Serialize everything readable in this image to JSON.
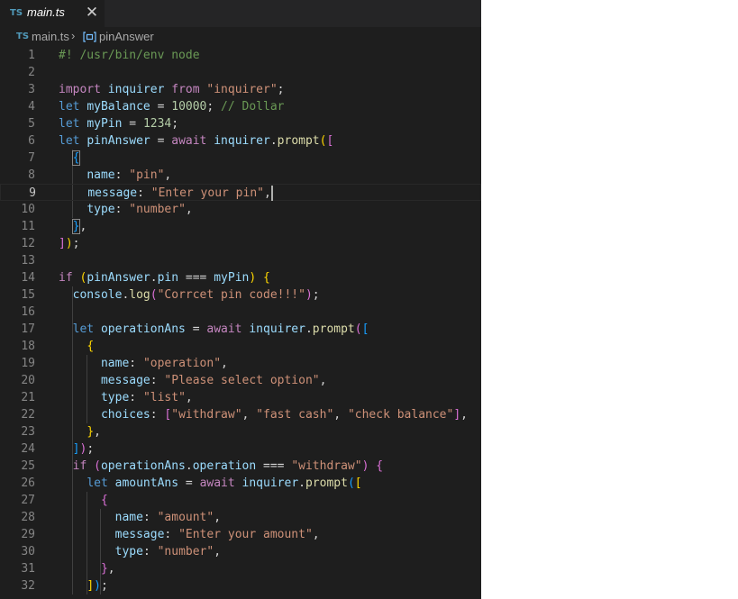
{
  "tab": {
    "lang_badge": "TS",
    "title": "main.ts",
    "close_glyph": "✕"
  },
  "breadcrumb": {
    "lang_badge": "TS",
    "file": "main.ts",
    "separator": "›",
    "symbol": "pinAnswer",
    "symbol_icon": "variable-icon"
  },
  "editor": {
    "cursor_line": 9,
    "lines": [
      {
        "n": "1",
        "tokens": [
          [
            "c",
            "#! /usr/bin/env node"
          ]
        ]
      },
      {
        "n": "2",
        "tokens": []
      },
      {
        "n": "3",
        "tokens": [
          [
            "kw",
            "import"
          ],
          [
            "p",
            " "
          ],
          [
            "v",
            "inquirer"
          ],
          [
            "p",
            " "
          ],
          [
            "kw",
            "from"
          ],
          [
            "p",
            " "
          ],
          [
            "s",
            "\"inquirer\""
          ],
          [
            "p",
            ";"
          ]
        ]
      },
      {
        "n": "4",
        "tokens": [
          [
            "kd",
            "let"
          ],
          [
            "p",
            " "
          ],
          [
            "v",
            "myBalance"
          ],
          [
            "p",
            " = "
          ],
          [
            "n",
            "10000"
          ],
          [
            "p",
            "; "
          ],
          [
            "c",
            "// Dollar"
          ]
        ]
      },
      {
        "n": "5",
        "tokens": [
          [
            "kd",
            "let"
          ],
          [
            "p",
            " "
          ],
          [
            "v",
            "myPin"
          ],
          [
            "p",
            " = "
          ],
          [
            "n",
            "1234"
          ],
          [
            "p",
            ";"
          ]
        ]
      },
      {
        "n": "6",
        "tokens": [
          [
            "kd",
            "let"
          ],
          [
            "p",
            " "
          ],
          [
            "v",
            "pinAnswer"
          ],
          [
            "p",
            " = "
          ],
          [
            "kw",
            "await"
          ],
          [
            "p",
            " "
          ],
          [
            "v",
            "inquirer"
          ],
          [
            "p",
            "."
          ],
          [
            "f",
            "prompt"
          ],
          [
            "b1",
            "("
          ],
          [
            "b2",
            "["
          ]
        ]
      },
      {
        "n": "7",
        "tokens": [
          [
            "p",
            "  "
          ],
          [
            "b3 bm",
            "{"
          ]
        ]
      },
      {
        "n": "8",
        "tokens": [
          [
            "p",
            "    "
          ],
          [
            "v",
            "name"
          ],
          [
            "p",
            ": "
          ],
          [
            "s",
            "\"pin\""
          ],
          [
            "p",
            ","
          ]
        ]
      },
      {
        "n": "9",
        "tokens": [
          [
            "p",
            "    "
          ],
          [
            "v",
            "message"
          ],
          [
            "p",
            ": "
          ],
          [
            "s",
            "\"Enter your pin\""
          ],
          [
            "p",
            ","
          ]
        ]
      },
      {
        "n": "10",
        "tokens": [
          [
            "p",
            "    "
          ],
          [
            "v",
            "type"
          ],
          [
            "p",
            ": "
          ],
          [
            "s",
            "\"number\""
          ],
          [
            "p",
            ","
          ]
        ]
      },
      {
        "n": "11",
        "tokens": [
          [
            "p",
            "  "
          ],
          [
            "b3 bm",
            "}"
          ],
          [
            "p",
            ","
          ]
        ]
      },
      {
        "n": "12",
        "tokens": [
          [
            "b2",
            "]"
          ],
          [
            "b1",
            ")"
          ],
          [
            "p",
            ";"
          ]
        ]
      },
      {
        "n": "13",
        "tokens": []
      },
      {
        "n": "14",
        "tokens": [
          [
            "kw",
            "if"
          ],
          [
            "p",
            " "
          ],
          [
            "b1",
            "("
          ],
          [
            "v",
            "pinAnswer"
          ],
          [
            "p",
            "."
          ],
          [
            "v",
            "pin"
          ],
          [
            "p",
            " === "
          ],
          [
            "v",
            "myPin"
          ],
          [
            "b1",
            ")"
          ],
          [
            "p",
            " "
          ],
          [
            "b1",
            "{"
          ]
        ]
      },
      {
        "n": "15",
        "tokens": [
          [
            "p",
            "  "
          ],
          [
            "v",
            "console"
          ],
          [
            "p",
            "."
          ],
          [
            "f",
            "log"
          ],
          [
            "b2",
            "("
          ],
          [
            "s",
            "\"Corrcet pin code!!!\""
          ],
          [
            "b2",
            ")"
          ],
          [
            "p",
            ";"
          ]
        ]
      },
      {
        "n": "16",
        "tokens": []
      },
      {
        "n": "17",
        "tokens": [
          [
            "p",
            "  "
          ],
          [
            "kd",
            "let"
          ],
          [
            "p",
            " "
          ],
          [
            "v",
            "operationAns"
          ],
          [
            "p",
            " = "
          ],
          [
            "kw",
            "await"
          ],
          [
            "p",
            " "
          ],
          [
            "v",
            "inquirer"
          ],
          [
            "p",
            "."
          ],
          [
            "f",
            "prompt"
          ],
          [
            "b2",
            "("
          ],
          [
            "b3",
            "["
          ]
        ]
      },
      {
        "n": "18",
        "tokens": [
          [
            "p",
            "    "
          ],
          [
            "b1",
            "{"
          ]
        ]
      },
      {
        "n": "19",
        "tokens": [
          [
            "p",
            "      "
          ],
          [
            "v",
            "name"
          ],
          [
            "p",
            ": "
          ],
          [
            "s",
            "\"operation\""
          ],
          [
            "p",
            ","
          ]
        ]
      },
      {
        "n": "20",
        "tokens": [
          [
            "p",
            "      "
          ],
          [
            "v",
            "message"
          ],
          [
            "p",
            ": "
          ],
          [
            "s",
            "\"Please select option\""
          ],
          [
            "p",
            ","
          ]
        ]
      },
      {
        "n": "21",
        "tokens": [
          [
            "p",
            "      "
          ],
          [
            "v",
            "type"
          ],
          [
            "p",
            ": "
          ],
          [
            "s",
            "\"list\""
          ],
          [
            "p",
            ","
          ]
        ]
      },
      {
        "n": "22",
        "tokens": [
          [
            "p",
            "      "
          ],
          [
            "v",
            "choices"
          ],
          [
            "p",
            ": "
          ],
          [
            "b2",
            "["
          ],
          [
            "s",
            "\"withdraw\""
          ],
          [
            "p",
            ", "
          ],
          [
            "s",
            "\"fast cash\""
          ],
          [
            "p",
            ", "
          ],
          [
            "s",
            "\"check balance\""
          ],
          [
            "b2",
            "]"
          ],
          [
            "p",
            ","
          ]
        ]
      },
      {
        "n": "23",
        "tokens": [
          [
            "p",
            "    "
          ],
          [
            "b1",
            "}"
          ],
          [
            "p",
            ","
          ]
        ]
      },
      {
        "n": "24",
        "tokens": [
          [
            "p",
            "  "
          ],
          [
            "b3",
            "]"
          ],
          [
            "b2",
            ")"
          ],
          [
            "p",
            ";"
          ]
        ]
      },
      {
        "n": "25",
        "tokens": [
          [
            "p",
            "  "
          ],
          [
            "kw",
            "if"
          ],
          [
            "p",
            " "
          ],
          [
            "b2",
            "("
          ],
          [
            "v",
            "operationAns"
          ],
          [
            "p",
            "."
          ],
          [
            "v",
            "operation"
          ],
          [
            "p",
            " === "
          ],
          [
            "s",
            "\"withdraw\""
          ],
          [
            "b2",
            ")"
          ],
          [
            "p",
            " "
          ],
          [
            "b2",
            "{"
          ]
        ]
      },
      {
        "n": "26",
        "tokens": [
          [
            "p",
            "    "
          ],
          [
            "kd",
            "let"
          ],
          [
            "p",
            " "
          ],
          [
            "v",
            "amountAns"
          ],
          [
            "p",
            " = "
          ],
          [
            "kw",
            "await"
          ],
          [
            "p",
            " "
          ],
          [
            "v",
            "inquirer"
          ],
          [
            "p",
            "."
          ],
          [
            "f",
            "prompt"
          ],
          [
            "b3",
            "("
          ],
          [
            "b1",
            "["
          ]
        ]
      },
      {
        "n": "27",
        "tokens": [
          [
            "p",
            "      "
          ],
          [
            "b2",
            "{"
          ]
        ]
      },
      {
        "n": "28",
        "tokens": [
          [
            "p",
            "        "
          ],
          [
            "v",
            "name"
          ],
          [
            "p",
            ": "
          ],
          [
            "s",
            "\"amount\""
          ],
          [
            "p",
            ","
          ]
        ]
      },
      {
        "n": "29",
        "tokens": [
          [
            "p",
            "        "
          ],
          [
            "v",
            "message"
          ],
          [
            "p",
            ": "
          ],
          [
            "s",
            "\"Enter your amount\""
          ],
          [
            "p",
            ","
          ]
        ]
      },
      {
        "n": "30",
        "tokens": [
          [
            "p",
            "        "
          ],
          [
            "v",
            "type"
          ],
          [
            "p",
            ": "
          ],
          [
            "s",
            "\"number\""
          ],
          [
            "p",
            ","
          ]
        ]
      },
      {
        "n": "31",
        "tokens": [
          [
            "p",
            "      "
          ],
          [
            "b2",
            "}"
          ],
          [
            "p",
            ","
          ]
        ]
      },
      {
        "n": "32",
        "tokens": [
          [
            "p",
            "    "
          ],
          [
            "b1",
            "]"
          ],
          [
            "b3",
            ")"
          ],
          [
            "p",
            ";"
          ]
        ]
      }
    ]
  }
}
